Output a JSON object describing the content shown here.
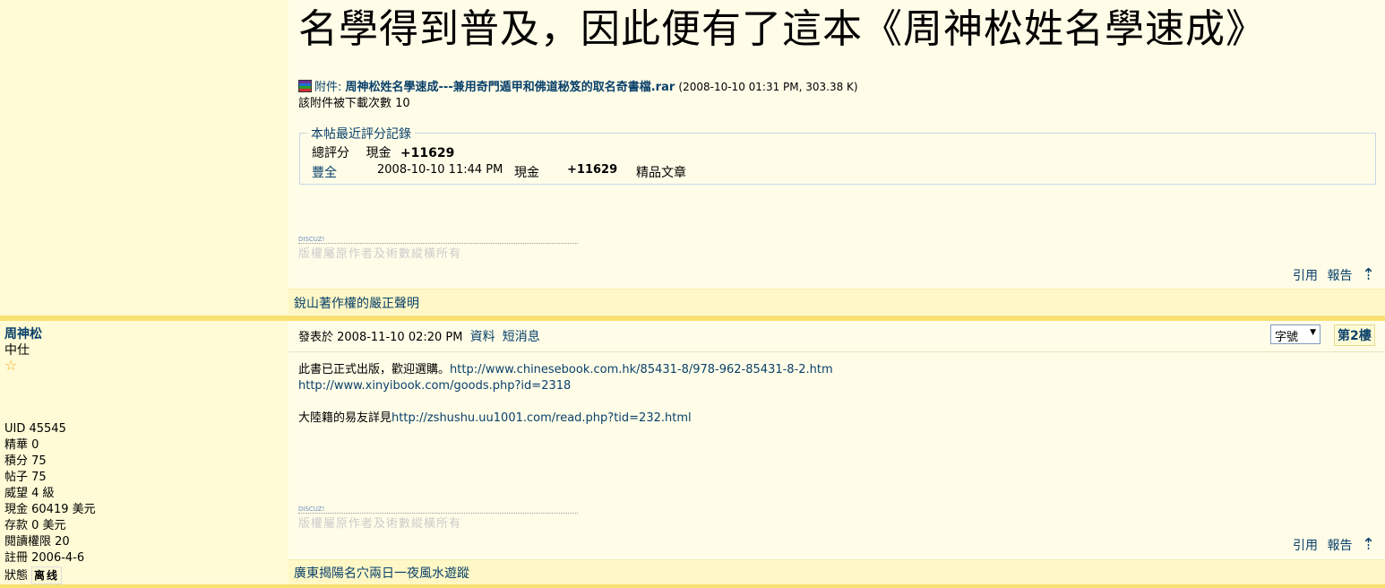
{
  "post1": {
    "big_title": "名學得到普及，因此便有了這本《周神松姓名學速成》",
    "attach_label": "附件:",
    "attach_filename": "周神松姓名學速成---兼用奇門遁甲和佛道秘笈的取名奇書檔.rar",
    "attach_meta": "(2008-10-10 01:31 PM, 303.38 K)",
    "download_text": "該附件被下載次數 10",
    "rating": {
      "legend": "本帖最近評分記錄",
      "total_label": "總評分",
      "total_currency": "現金",
      "total_value": "+11629",
      "rater": "豐全",
      "rate_time": "2008-10-10 11:44 PM",
      "rate_currency": "現金",
      "rate_value": "+11629",
      "rate_reason": "精品文章"
    },
    "sig_small": "DISCUZ!",
    "sig_text": "版權屬原作者及術數縱橫所有",
    "quote": "引用",
    "report": "報告",
    "footer": "銳山著作權的嚴正聲明"
  },
  "post2": {
    "author": "周神松",
    "rank": "中仕",
    "star": "☆",
    "stats": {
      "uid": "UID 45545",
      "digest": "精華 0",
      "points": "積分 75",
      "posts": "帖子 75",
      "prestige": "威望 4 級",
      "cash": "現金 60419 美元",
      "deposit": "存款 0 美元",
      "read_perm": "閱讀權限 20",
      "register": "註冊 2006-4-6",
      "status_label": "狀態",
      "status_value": "离线"
    },
    "posted_at": "發表於 2008-11-10 02:20 PM",
    "profile": "資料",
    "pm": "短消息",
    "font_select": "字號",
    "floor": "第2樓",
    "body_line1_text": "此書已正式出版，歡迎選購。",
    "body_link1": "http://www.chinesebook.com.hk/85431-8/978-962-85431-8-2.htm",
    "body_link2": "http://www.xinyibook.com/goods.php?id=2318",
    "body_line3_text": "大陸籍的易友詳見",
    "body_link3": "http://zshushu.uu1001.com/read.php?tid=232.html",
    "sig_small": "DISCUZ!",
    "sig_text": "版權屬原作者及術數縱橫所有",
    "quote": "引用",
    "report": "報告",
    "footer": "廣東揭陽名穴兩日一夜風水遊蹤"
  }
}
